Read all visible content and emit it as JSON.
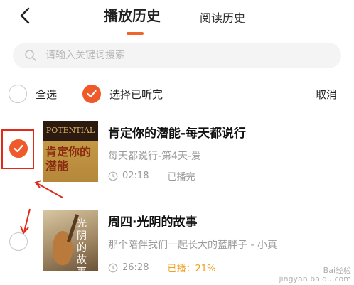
{
  "header": {
    "tabs": [
      {
        "label": "播放历史",
        "active": true
      },
      {
        "label": "阅读历史",
        "active": false
      }
    ],
    "back_icon": "chevron-left-icon"
  },
  "search": {
    "placeholder": "请输入关键词搜索",
    "value": ""
  },
  "toolbar": {
    "select_all_label": "全选",
    "select_finished_label": "选择已听完",
    "cancel_label": "取消"
  },
  "items": [
    {
      "title": "肯定你的潜能-每天都说行",
      "subtitle": "每天都说行-第4天-爱",
      "duration": "02:18",
      "status": "已播完",
      "selected": true,
      "cover_text_top": "POTENTIAL",
      "cover_text_title": "肯定你的潜能"
    },
    {
      "title": "周四·光阴的故事",
      "subtitle": "那个陪伴我们一起长大的蓝胖子 - 小真",
      "duration": "26:28",
      "status": "已播：21%",
      "selected": false,
      "cover_text_title": "光阴的故事"
    }
  ],
  "colors": {
    "accent": "#f05a2a",
    "progress_status": "#f0a020",
    "annotation": "#e02a1a"
  },
  "watermark": {
    "line1": "Bai经验",
    "line2": "jingyan.baidu.com"
  }
}
